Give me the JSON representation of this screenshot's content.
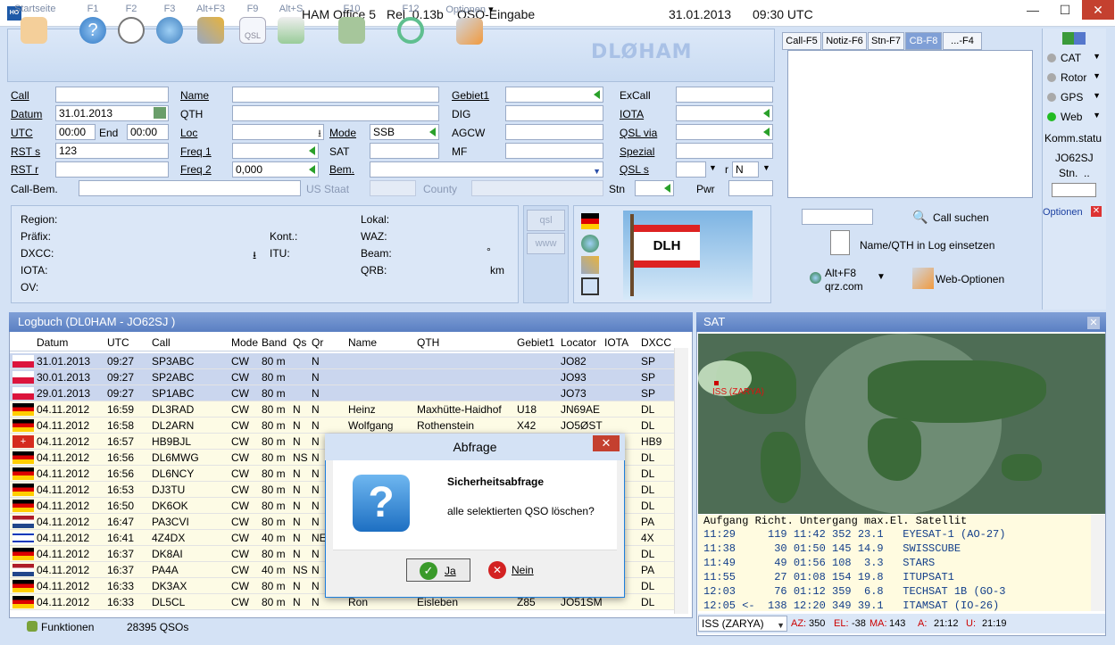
{
  "window": {
    "title": "HAM Office 5",
    "release": "Rel. 0.13b",
    "mode_title": "QSO-Eingabe",
    "date": "31.01.2013",
    "time": "09:30 UTC"
  },
  "toolbar": {
    "items": [
      {
        "label": "Startseite",
        "icon": "home-icon"
      },
      {
        "label": "F1",
        "icon": "help-icon"
      },
      {
        "label": "F2",
        "icon": "clock-icon"
      },
      {
        "label": "F3",
        "icon": "globe-icon"
      },
      {
        "label": "Alt+F3",
        "icon": "satellite-icon"
      },
      {
        "label": "F9",
        "icon": "qsl-icon"
      },
      {
        "label": "Alt+S",
        "icon": "stats-icon"
      },
      {
        "label": "F10",
        "icon": "save-icon"
      },
      {
        "label": "F12",
        "icon": "refresh-icon"
      },
      {
        "label": "Optionen",
        "icon": "tools-icon"
      }
    ],
    "qsl_caption": "QSL",
    "callsign": "DLØHAM"
  },
  "form": {
    "labels": {
      "call": "Call",
      "datum": "Datum",
      "utc": "UTC",
      "end": "End",
      "rst_s": "RST s",
      "rst_r": "RST r",
      "call_bem": "Call-Bem.",
      "name": "Name",
      "qth": "QTH",
      "loc": "Loc",
      "freq1": "Freq 1",
      "freq2": "Freq 2",
      "mode": "Mode",
      "sat": "SAT",
      "bem": "Bem.",
      "gebiet1": "Gebiet1",
      "dig": "DIG",
      "agcw": "AGCW",
      "mf": "MF",
      "excall": "ExCall",
      "iota": "IOTA",
      "qsl_via": "QSL via",
      "spezial": "Spezial",
      "qsl_s": "QSL s",
      "r": "r",
      "us_staat": "US Staat",
      "county": "County",
      "stn": "Stn",
      "pwr": "Pwr"
    },
    "values": {
      "datum": "31.01.2013",
      "utc": "00:00",
      "end": "00:00",
      "rst_s": "123",
      "mode": "SSB",
      "freq2": "0,000",
      "qsl_r": "N"
    }
  },
  "info": {
    "region": "Region:",
    "praefix": "Präfix:",
    "kont": "Kont.:",
    "dxcc": "DXCC:",
    "itu": "ITU:",
    "iota": "IOTA:",
    "ov": "OV:",
    "lokal": "Lokal:",
    "waz": "WAZ:",
    "beam": "Beam:",
    "beam_unit": "°",
    "qrb": "QRB:",
    "qrb_unit": "km",
    "qsl_btn": "qsl",
    "www_btn": "www",
    "flag_text": "DLH"
  },
  "rightpane": {
    "tabs": [
      "Call-F5",
      "Notiz-F6",
      "Stn-F7",
      "CB-F8",
      "...-F4"
    ],
    "active_tab": "CB-F8",
    "call_suchen": "Call suchen",
    "log_einsetzen": "Name/QTH in Log einsetzen",
    "qrz_label1": "Alt+F8",
    "qrz_label2": "qrz.com",
    "web_optionen": "Web-Optionen"
  },
  "side": {
    "items": [
      "CAT",
      "Rotor",
      "GPS",
      "Web"
    ],
    "komm": "Komm.statu",
    "locator": "JO62SJ",
    "stn": "Stn.  ..",
    "optionen": "Optionen"
  },
  "log": {
    "title": "Logbuch  (DL0HAM - JO62SJ )",
    "columns": [
      "Datum",
      "UTC",
      "Call",
      "Mode",
      "Band",
      "Qs",
      "Qr",
      "Name",
      "QTH",
      "Gebiet1",
      "Locator",
      "IOTA",
      "DXCC"
    ],
    "rows": [
      {
        "flag": "pl",
        "datum": "31.01.2013",
        "utc": "09:27",
        "call": "SP3ABC",
        "mode": "CW",
        "band": "80 m",
        "qs": "",
        "qr": "N",
        "name": "",
        "qth": "",
        "gebiet": "",
        "loc": "JO82",
        "iota": "",
        "dxcc": "SP",
        "sel": true
      },
      {
        "flag": "pl",
        "datum": "30.01.2013",
        "utc": "09:27",
        "call": "SP2ABC",
        "mode": "CW",
        "band": "80 m",
        "qs": "",
        "qr": "N",
        "name": "",
        "qth": "",
        "gebiet": "",
        "loc": "JO93",
        "iota": "",
        "dxcc": "SP",
        "sel": true
      },
      {
        "flag": "pl",
        "datum": "29.01.2013",
        "utc": "09:27",
        "call": "SP1ABC",
        "mode": "CW",
        "band": "80 m",
        "qs": "",
        "qr": "N",
        "name": "",
        "qth": "",
        "gebiet": "",
        "loc": "JO73",
        "iota": "",
        "dxcc": "SP",
        "sel": true
      },
      {
        "flag": "de",
        "datum": "04.11.2012",
        "utc": "16:59",
        "call": "DL3RAD",
        "mode": "CW",
        "band": "80 m",
        "qs": "N",
        "qr": "N",
        "name": "Heinz",
        "qth": "Maxhütte-Haidhof",
        "gebiet": "U18",
        "loc": "JN69AE",
        "iota": "",
        "dxcc": "DL",
        "sel": false
      },
      {
        "flag": "de",
        "datum": "04.11.2012",
        "utc": "16:58",
        "call": "DL2ARN",
        "mode": "CW",
        "band": "80 m",
        "qs": "N",
        "qr": "N",
        "name": "Wolfgang",
        "qth": "Rothenstein",
        "gebiet": "X42",
        "loc": "JO5ØST",
        "iota": "",
        "dxcc": "DL",
        "sel": false
      },
      {
        "flag": "ch",
        "datum": "04.11.2012",
        "utc": "16:57",
        "call": "HB9BJL",
        "mode": "CW",
        "band": "80 m",
        "qs": "N",
        "qr": "N",
        "name": "",
        "qth": "",
        "gebiet": "",
        "loc": "",
        "iota": "",
        "dxcc": "HB9",
        "sel": false
      },
      {
        "flag": "de",
        "datum": "04.11.2012",
        "utc": "16:56",
        "call": "DL6MWG",
        "mode": "CW",
        "band": "80 m",
        "qs": "NS",
        "qr": "N",
        "name": "",
        "qth": "",
        "gebiet": "",
        "loc": "",
        "iota": "",
        "dxcc": "DL",
        "sel": false
      },
      {
        "flag": "de",
        "datum": "04.11.2012",
        "utc": "16:56",
        "call": "DL6NCY",
        "mode": "CW",
        "band": "80 m",
        "qs": "N",
        "qr": "N",
        "name": "",
        "qth": "",
        "gebiet": "",
        "loc": "",
        "iota": "",
        "dxcc": "DL",
        "sel": false
      },
      {
        "flag": "de",
        "datum": "04.11.2012",
        "utc": "16:53",
        "call": "DJ3TU",
        "mode": "CW",
        "band": "80 m",
        "qs": "N",
        "qr": "N",
        "name": "",
        "qth": "",
        "gebiet": "",
        "loc": "",
        "iota": "",
        "dxcc": "DL",
        "sel": false
      },
      {
        "flag": "de",
        "datum": "04.11.2012",
        "utc": "16:50",
        "call": "DK6OK",
        "mode": "CW",
        "band": "80 m",
        "qs": "N",
        "qr": "N",
        "name": "",
        "qth": "",
        "gebiet": "",
        "loc": "",
        "iota": "",
        "dxcc": "DL",
        "sel": false
      },
      {
        "flag": "nl",
        "datum": "04.11.2012",
        "utc": "16:47",
        "call": "PA3CVI",
        "mode": "CW",
        "band": "80 m",
        "qs": "N",
        "qr": "N",
        "name": "",
        "qth": "",
        "gebiet": "",
        "loc": "",
        "iota": "",
        "dxcc": "PA",
        "sel": false
      },
      {
        "flag": "il",
        "datum": "04.11.2012",
        "utc": "16:41",
        "call": "4Z4DX",
        "mode": "CW",
        "band": "40 m",
        "qs": "N",
        "qr": "NE",
        "name": "",
        "qth": "",
        "gebiet": "",
        "loc": "",
        "iota": "",
        "dxcc": "4X",
        "sel": false
      },
      {
        "flag": "de",
        "datum": "04.11.2012",
        "utc": "16:37",
        "call": "DK8AI",
        "mode": "CW",
        "band": "80 m",
        "qs": "N",
        "qr": "N",
        "name": "",
        "qth": "",
        "gebiet": "",
        "loc": "",
        "iota": "",
        "dxcc": "DL",
        "sel": false
      },
      {
        "flag": "nl",
        "datum": "04.11.2012",
        "utc": "16:37",
        "call": "PA4A",
        "mode": "CW",
        "band": "40 m",
        "qs": "NS",
        "qr": "N",
        "name": "",
        "qth": "",
        "gebiet": "",
        "loc": "",
        "iota": "",
        "dxcc": "PA",
        "sel": false
      },
      {
        "flag": "de",
        "datum": "04.11.2012",
        "utc": "16:33",
        "call": "DK3AX",
        "mode": "CW",
        "band": "80 m",
        "qs": "N",
        "qr": "N",
        "name": "",
        "qth": "",
        "gebiet": "",
        "loc": "",
        "iota": "",
        "dxcc": "DL",
        "sel": false
      },
      {
        "flag": "de",
        "datum": "04.11.2012",
        "utc": "16:33",
        "call": "DL5CL",
        "mode": "CW",
        "band": "80 m",
        "qs": "N",
        "qr": "N",
        "name": "Ron",
        "qth": "Eisleben",
        "gebiet": "Z85",
        "loc": "JO51SM",
        "iota": "",
        "dxcc": "DL",
        "sel": false
      }
    ]
  },
  "status": {
    "funktionen": "Funktionen",
    "count": "28395 QSOs"
  },
  "sat": {
    "title": "SAT",
    "marker": "ISS (ZARYA)",
    "table_header": "Aufgang Richt. Untergang max.El. Satellit",
    "rows": [
      "11:29     119 11:42 352 23.1   EYESAT-1 (AO-27)",
      "11:38      30 01:50 145 14.9   SWISSCUBE",
      "11:49      49 01:56 108  3.3   STARS",
      "11:55      27 01:08 154 19.8   ITUPSAT1",
      "12:03      76 01:12 359  6.8   TECHSAT 1B (GO-3",
      "12:05 <-  138 12:20 349 39.1   ITAMSAT (IO-26)"
    ],
    "select": "ISS (ZARYA)",
    "az_label": "AZ:",
    "az": "350",
    "el_label": "EL:",
    "el": "-38",
    "ma_label": "MA:",
    "ma": "143",
    "a_label": "A:",
    "a": "21:12",
    "u_label": "U:",
    "u": "21:19"
  },
  "dialog": {
    "title": "Abfrage",
    "heading": "Sicherheitsabfrage",
    "message": "alle selektierten QSO löschen?",
    "yes": "Ja",
    "no": "Nein"
  },
  "colors": {
    "accent": "#5a7fc2",
    "selected_row": "#cad6ee",
    "log_row": "#fdfbe5",
    "field_arrow": "#2aa02a",
    "close_red": "#c4402f"
  }
}
